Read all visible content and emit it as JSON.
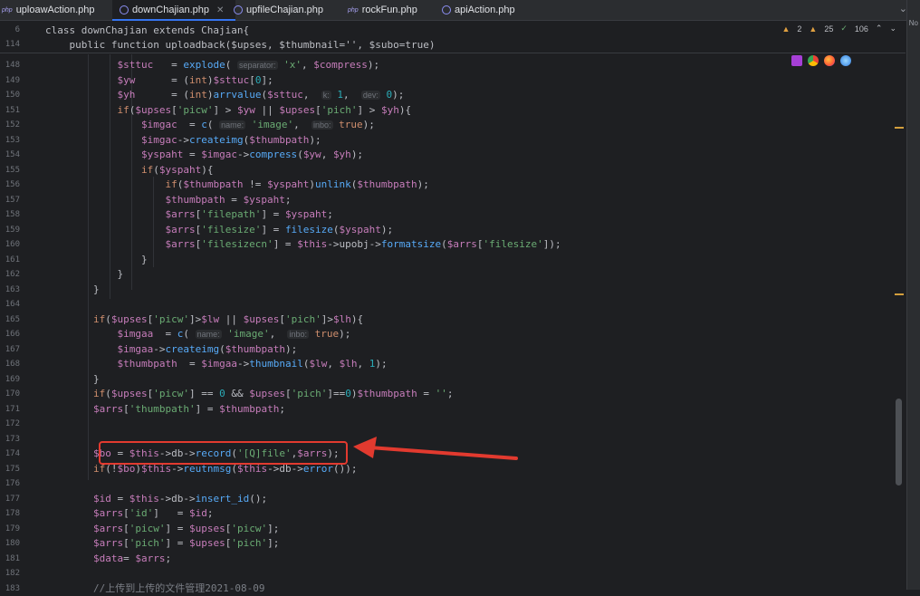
{
  "tabs": [
    {
      "label": "uploawAction.php",
      "badge": "php"
    },
    {
      "label": "downChajian.php",
      "active": true
    },
    {
      "label": "upfileChajian.php"
    },
    {
      "label": "rockFun.php",
      "badge": "php"
    },
    {
      "label": "apiAction.php"
    }
  ],
  "right_edge_text": "No",
  "sticky": {
    "line1_no": "6",
    "line1_code": "class downChajian extends Chajian{",
    "line2_no": "114",
    "line2_code": "    public function uploadback($upses, $thumbnail='', $subo=true)"
  },
  "inspections": {
    "warnings": "2",
    "weak": "25",
    "ok": "106"
  },
  "colors": {
    "accent": "#3574f0",
    "annotation": "#e23a2f"
  },
  "lines": [
    {
      "no": "148",
      "code": "            $sttuc   = explode( separator: 'x', $compress);"
    },
    {
      "no": "149",
      "code": "            $yw      = (int)$sttuc[0];"
    },
    {
      "no": "150",
      "code": "            $yh      = (int)arrvalue($sttuc,  k: 1,  dev: 0);"
    },
    {
      "no": "151",
      "code": "            if($upses['picw'] > $yw || $upses['pich'] > $yh){"
    },
    {
      "no": "152",
      "code": "                $imgac  = c( name: 'image',  inbo: true);"
    },
    {
      "no": "153",
      "code": "                $imgac->createimg($thumbpath);"
    },
    {
      "no": "154",
      "code": "                $yspaht = $imgac->compress($yw, $yh);"
    },
    {
      "no": "155",
      "code": "                if($yspaht){"
    },
    {
      "no": "156",
      "code": "                    if($thumbpath != $yspaht)unlink($thumbpath);"
    },
    {
      "no": "157",
      "code": "                    $thumbpath = $yspaht;"
    },
    {
      "no": "158",
      "code": "                    $arrs['filepath'] = $yspaht;"
    },
    {
      "no": "159",
      "code": "                    $arrs['filesize'] = filesize($yspaht);"
    },
    {
      "no": "160",
      "code": "                    $arrs['filesizecn'] = $this->upobj->formatsize($arrs['filesize']);"
    },
    {
      "no": "161",
      "code": "                }"
    },
    {
      "no": "162",
      "code": "            }"
    },
    {
      "no": "163",
      "code": "        }"
    },
    {
      "no": "164",
      "code": ""
    },
    {
      "no": "165",
      "code": "        if($upses['picw']>$lw || $upses['pich']>$lh){"
    },
    {
      "no": "166",
      "code": "            $imgaa  = c( name: 'image',  inbo: true);"
    },
    {
      "no": "167",
      "code": "            $imgaa->createimg($thumbpath);"
    },
    {
      "no": "168",
      "code": "            $thumbpath  = $imgaa->thumbnail($lw, $lh, 1);"
    },
    {
      "no": "169",
      "code": "        }"
    },
    {
      "no": "170",
      "code": "        if($upses['picw'] == 0 && $upses['pich']==0)$thumbpath = '';"
    },
    {
      "no": "171",
      "code": "        $arrs['thumbpath'] = $thumbpath;"
    },
    {
      "no": "172",
      "code": ""
    },
    {
      "no": "173",
      "code": ""
    },
    {
      "no": "174",
      "code": "        $bo = $this->db->record('[Q]file',$arrs);"
    },
    {
      "no": "175",
      "code": "        if(!$bo)$this->reutnmsg($this->db->error());"
    },
    {
      "no": "176",
      "code": ""
    },
    {
      "no": "177",
      "code": "        $id = $this->db->insert_id();"
    },
    {
      "no": "178",
      "code": "        $arrs['id']   = $id;"
    },
    {
      "no": "179",
      "code": "        $arrs['picw'] = $upses['picw'];"
    },
    {
      "no": "180",
      "code": "        $arrs['pich'] = $upses['pich'];"
    },
    {
      "no": "181",
      "code": "        $data= $arrs;"
    },
    {
      "no": "182",
      "code": ""
    },
    {
      "no": "183",
      "code": "        //上传到上传的文件管理2021-08-09"
    }
  ]
}
